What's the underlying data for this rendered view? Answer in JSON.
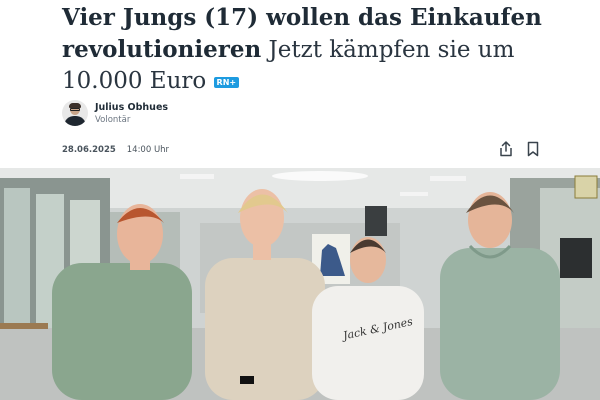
{
  "article": {
    "headline_bold": "Vier Jungs (17) wollen das Einkaufen re­volutionieren",
    "headline_light": "Jetzt kämpfen sie um 10.000 Euro",
    "badge": "RN+"
  },
  "author": {
    "name": "Julius Obhues",
    "role": "Volontär"
  },
  "meta": {
    "date": "28.06.2025",
    "time": "14:00 Uhr"
  },
  "actions": {
    "share_icon": "share-icon",
    "bookmark_icon": "bookmark-icon"
  },
  "photo": {
    "hoodie_print": "Jack & Jones"
  },
  "colors": {
    "badge": "#1d9be0",
    "text": "#1f2b36"
  }
}
